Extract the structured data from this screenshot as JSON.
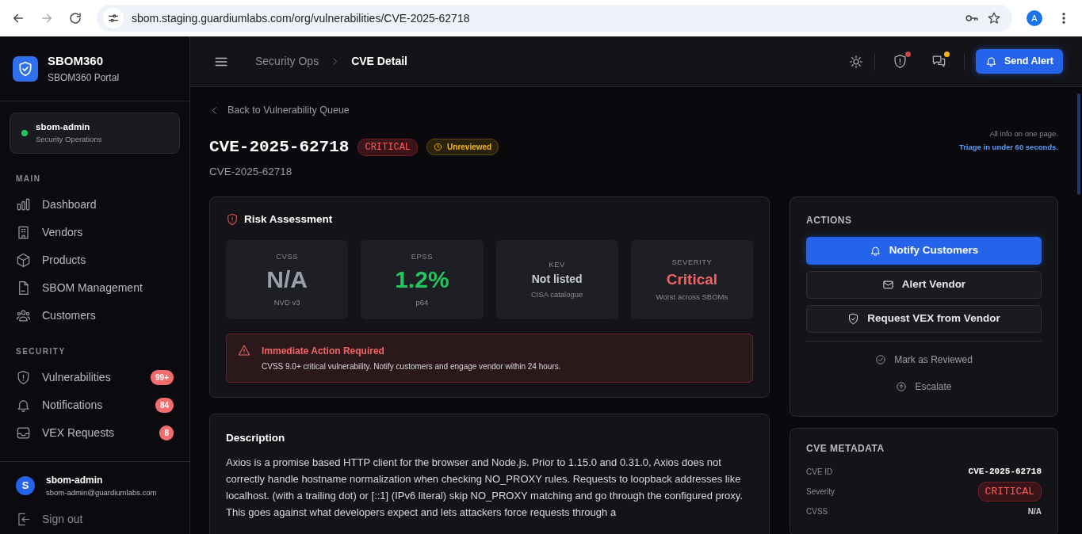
{
  "browser": {
    "url": "sbom.staging.guardiumlabs.com/org/vulnerabilities/CVE-2025-62718",
    "avatar_letter": "A"
  },
  "sidebar": {
    "brand": {
      "name": "SBOM360",
      "subtitle": "SBOM360 Portal"
    },
    "user_card": {
      "name": "sbom-admin",
      "role": "Security Operations",
      "online": true
    },
    "sections": [
      {
        "title": "MAIN",
        "items": [
          {
            "label": "Dashboard",
            "selected": false
          },
          {
            "label": "Vendors",
            "selected": false
          },
          {
            "label": "Products",
            "selected": false
          },
          {
            "label": "SBOM Management",
            "selected": false
          },
          {
            "label": "Customers",
            "selected": false
          }
        ]
      },
      {
        "title": "SECURITY",
        "items": [
          {
            "label": "Vulnerabilities",
            "badge": "99+",
            "selected": false
          },
          {
            "label": "Notifications",
            "badge": "84",
            "selected": false
          },
          {
            "label": "VEX Requests",
            "badge": "8",
            "selected": false
          }
        ]
      }
    ],
    "footer": {
      "avatar_letter": "S",
      "name": "sbom-admin",
      "email": "sbom-admin@guardiumlabs.com",
      "sign_out": "Sign out"
    }
  },
  "topbar": {
    "breadcrumb": [
      "Security Ops",
      "CVE Detail"
    ],
    "indicators": [
      {
        "kind": "shield",
        "color": "#c24a4a"
      },
      {
        "kind": "chat",
        "color": "#f5b70a"
      }
    ],
    "send_alert": "Send Alert"
  },
  "header": {
    "back_link": "Back to Vulnerability Queue",
    "title": "CVE-2025-62718",
    "severity": "CRITICAL",
    "status": "Unreviewed",
    "subtitle": "CVE-2025-62718",
    "tagline": "All info on one page.",
    "tagline_highlight": "Triage in under 60 seconds."
  },
  "risk": {
    "title": "Risk Assessment",
    "metrics": [
      {
        "label": "CVSS",
        "value": "N/A",
        "caption": "NVD v3"
      },
      {
        "label": "EPSS",
        "value": "1.2%",
        "caption": "p64"
      },
      {
        "label": "KEV",
        "value": "Not listed",
        "caption": "CISA catalogue"
      },
      {
        "label": "SEVERITY",
        "value": "Critical",
        "caption": "Worst across SBOMs"
      }
    ],
    "alert": {
      "title": "Immediate Action Required",
      "text": "CVSS 9.0+ critical vulnerability. Notify customers and engage vendor within 24 hours."
    }
  },
  "description": {
    "title": "Description",
    "text": "Axios is a promise based HTTP client for the browser and Node.js. Prior to 1.15.0 and 0.31.0, Axios does not correctly handle hostname normalization when checking NO_PROXY rules. Requests to loopback addresses like localhost. (with a trailing dot) or [::1] (IPv6 literal) skip NO_PROXY matching and go through the configured proxy. This goes against what developers expect and lets attackers force requests through a"
  },
  "actions": {
    "title": "ACTIONS",
    "buttons": [
      {
        "label": "Notify Customers",
        "kind": "primary"
      },
      {
        "label": "Alert Vendor",
        "kind": "secondary"
      },
      {
        "label": "Request VEX from Vendor",
        "kind": "secondary"
      },
      {
        "label": "Mark as Reviewed",
        "kind": "link"
      },
      {
        "label": "Escalate",
        "kind": "link"
      }
    ]
  },
  "metadata": {
    "title": "CVE METADATA",
    "rows": [
      {
        "label": "CVE ID",
        "value": "CVE-2025-62718",
        "kind": "mono"
      },
      {
        "label": "Severity",
        "value": "CRITICAL",
        "kind": "badge"
      },
      {
        "label": "CVSS",
        "value": "N/A",
        "kind": "text"
      }
    ]
  }
}
